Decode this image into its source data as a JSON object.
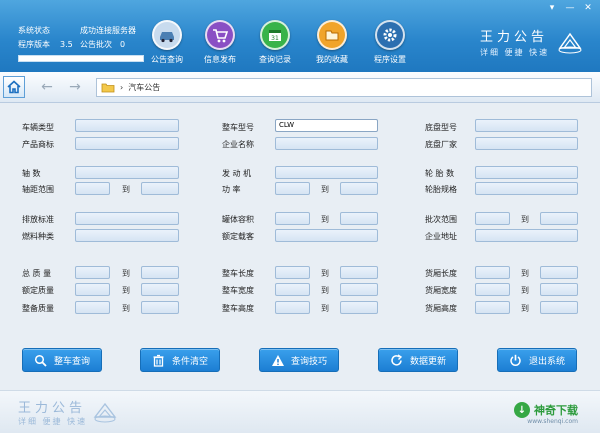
{
  "window": {
    "minimize_glyph": "▾",
    "min_glyph": "—",
    "close_glyph": "✕"
  },
  "status": {
    "row1_label": "系统状态",
    "row1_value": "成功连接服务器",
    "row2_label": "程序版本",
    "row2_value": "3.5",
    "row2b_label": "公告批次",
    "row2b_value": "0",
    "progress": 1.0
  },
  "nav": [
    {
      "label": "公告查询",
      "icon": "car-search-icon",
      "color": "#bcd3e8"
    },
    {
      "label": "信息发布",
      "icon": "cart-icon",
      "color": "#8a4fc4"
    },
    {
      "label": "查询记录",
      "icon": "calendar-icon",
      "color": "#39b34a"
    },
    {
      "label": "我的收藏",
      "icon": "folder-icon",
      "color": "#f0a42a"
    },
    {
      "label": "程序设置",
      "icon": "gear-icon",
      "color": "#2c6fb0"
    }
  ],
  "logo": {
    "title": "王力公告",
    "subtitle": "详细 便捷 快速"
  },
  "addressbar": {
    "crumb": "汽车公告"
  },
  "form": {
    "dao": "到",
    "vehicle_type": "车辆类型",
    "product_brand": "产品商标",
    "axle_count": "轴    数",
    "wheelbase_range": "轴距范围",
    "emission_std": "排放标准",
    "fuel_type": "燃料种类",
    "total_mass": "总 质 量",
    "rated_mass": "额定质量",
    "curb_mass": "整备质量",
    "vehicle_model": "整车型号",
    "vehicle_model_value": "CLW",
    "company_name": "企业名称",
    "engine": "发 动 机",
    "power": "功    率",
    "tank_volume": "罐体容积",
    "rated_passengers": "额定载客",
    "vehicle_length": "整车长度",
    "vehicle_width": "整车宽度",
    "vehicle_height": "整车高度",
    "chassis_model": "底盘型号",
    "chassis_maker": "底盘厂家",
    "tire_count": "轮 胎 数",
    "tire_spec": "轮胎规格",
    "batch_range": "批次范围",
    "company_address": "企业地址",
    "cargo_length": "货厢长度",
    "cargo_width": "货厢宽度",
    "cargo_height": "货厢高度"
  },
  "actions": {
    "query": "整车查询",
    "clear": "条件清空",
    "tips": "查询技巧",
    "update": "数据更新",
    "exit": "退出系统"
  },
  "footer": {
    "title": "王力公告",
    "subtitle": "详细 便捷 快速",
    "brand": "神奇下载",
    "brand_icon": "↓",
    "brand_url": "www.shenqi.com"
  }
}
